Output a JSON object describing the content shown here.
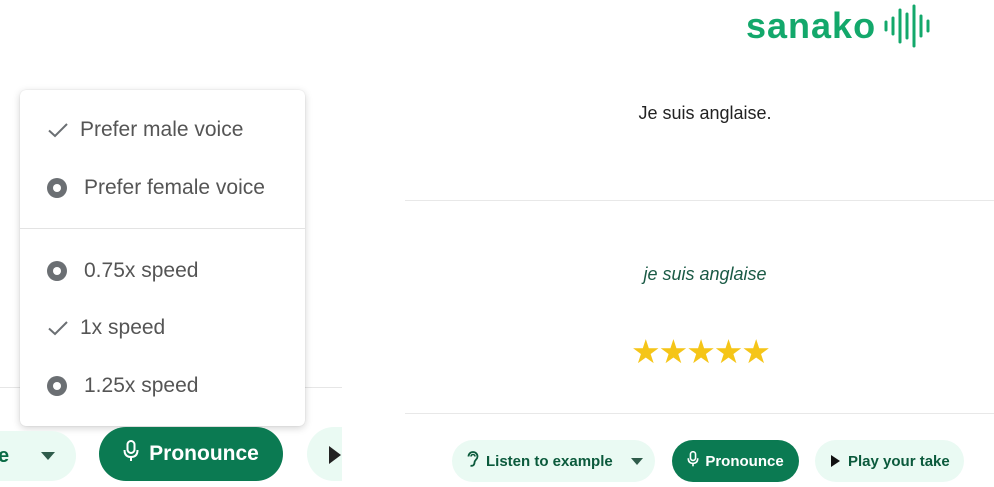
{
  "brand": {
    "name": "sanako",
    "color": "#13a86b"
  },
  "voice_menu": {
    "items": [
      {
        "label": "Prefer male voice",
        "state": "checked"
      },
      {
        "label": "Prefer female voice",
        "state": "radio"
      },
      {
        "label": "0.75x speed",
        "state": "radio"
      },
      {
        "label": "1x speed",
        "state": "checked"
      },
      {
        "label": "1.25x speed",
        "state": "radio"
      }
    ]
  },
  "left_toolbar": {
    "listen_partial_label": "e",
    "pronounce_label": "Pronounce"
  },
  "exercise": {
    "sentence": "Je suis anglaise.",
    "transcript": "je suis anglaise",
    "rating": {
      "stars": 5,
      "max": 5
    }
  },
  "toolbar": {
    "listen_label": "Listen to example",
    "pronounce_label": "Pronounce",
    "play_label": "Play your take"
  },
  "colors": {
    "accent": "#0b7a52",
    "pill_bg": "#eafaf3",
    "star": "#f5c518"
  }
}
